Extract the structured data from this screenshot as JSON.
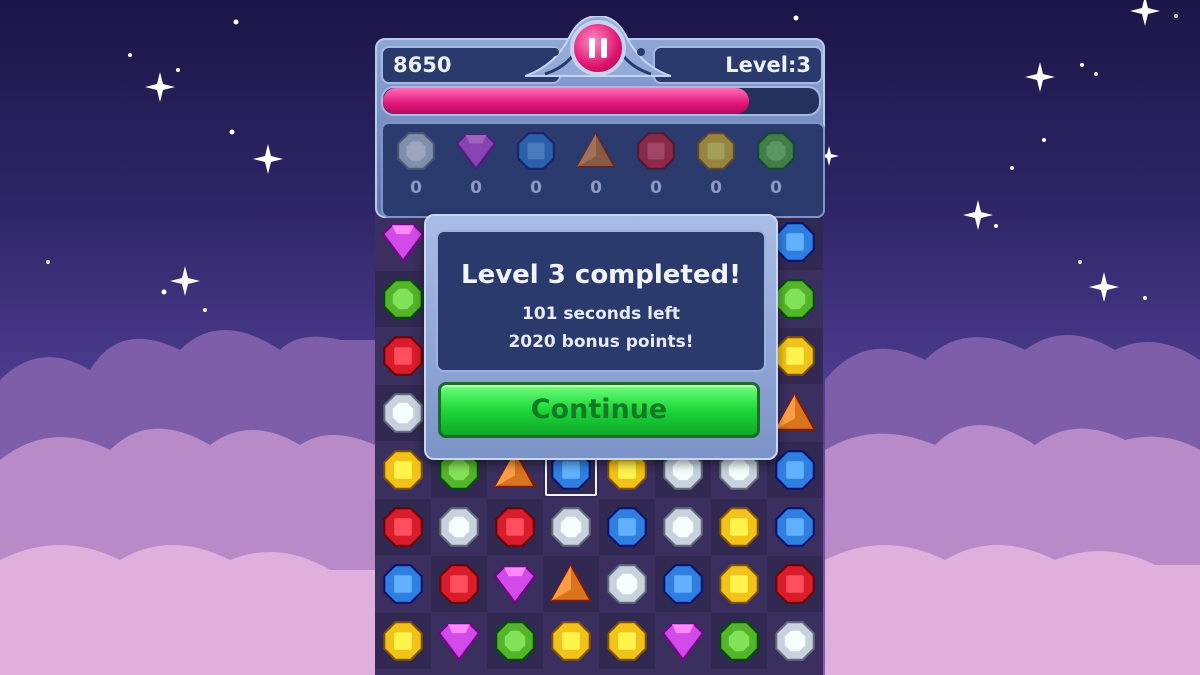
{
  "hud": {
    "score": "8650",
    "level": "Level:3",
    "progress_fraction": 0.84,
    "pause_icon": "pause-icon"
  },
  "gem_counters": [
    {
      "gem": "white",
      "count": "0"
    },
    {
      "gem": "purple",
      "count": "0"
    },
    {
      "gem": "blue",
      "count": "0"
    },
    {
      "gem": "orange",
      "count": "0"
    },
    {
      "gem": "red",
      "count": "0"
    },
    {
      "gem": "yellow",
      "count": "0"
    },
    {
      "gem": "green",
      "count": "0"
    }
  ],
  "dialog": {
    "title": "Level 3 completed!",
    "line1": "101 seconds left",
    "line2": "2020 bonus points!",
    "button": "Continue"
  },
  "board": [
    [
      "purple",
      "",
      "",
      "",
      "",
      "",
      "",
      "blue"
    ],
    [
      "green",
      "",
      "",
      "",
      "",
      "",
      "",
      "green"
    ],
    [
      "red",
      "",
      "",
      "",
      "",
      "",
      "",
      "yellow"
    ],
    [
      "white",
      "",
      "",
      "",
      "",
      "",
      "",
      "orange"
    ],
    [
      "yellow",
      "green",
      "orange",
      "blue",
      "yellow",
      "white",
      "white",
      "blue"
    ],
    [
      "red",
      "white",
      "red",
      "white",
      "blue",
      "white",
      "yellow",
      "blue"
    ],
    [
      "blue",
      "red",
      "purple",
      "orange",
      "white",
      "blue",
      "yellow",
      "red"
    ],
    [
      "yellow",
      "purple",
      "green",
      "yellow",
      "yellow",
      "purple",
      "green",
      "white"
    ]
  ],
  "selected_cell": {
    "row": 4,
    "col": 3
  },
  "colors": {
    "white": "#c7d2de",
    "purple": "#d24be8",
    "blue": "#2f7fe0",
    "orange": "#d9751f",
    "red": "#d81c2c",
    "yellow": "#f0c21a",
    "green": "#55b52a",
    "progress": "#e2157a",
    "button": "#1dd838"
  }
}
